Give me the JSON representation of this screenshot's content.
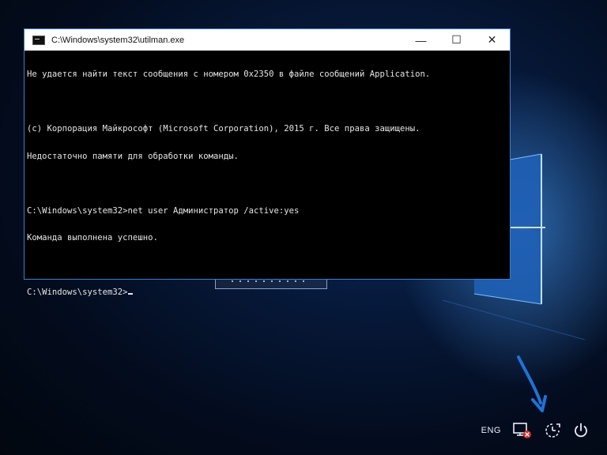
{
  "window": {
    "title": "C:\\Windows\\system32\\utilman.exe",
    "minimize_label": "—",
    "maximize_label": "☐",
    "close_label": "✕"
  },
  "console": {
    "lines": [
      "Не удается найти текст сообщения с номером 0x2350 в файле сообщений Application.",
      "",
      "(c) Корпорация Майкрософт (Microsoft Corporation), 2015 г. Все права защищены.",
      "Недостаточно памяти для обработки команды.",
      "",
      "C:\\Windows\\system32>net user Администратор /active:yes",
      "Команда выполнена успешно.",
      "",
      "C:\\Windows\\system32>"
    ]
  },
  "tray": {
    "language": "ENG",
    "icons": [
      "network-disconnected-icon",
      "ease-of-access-icon",
      "power-icon"
    ]
  },
  "colors": {
    "accent": "#3c7fd1",
    "console_bg": "#000000",
    "arrow": "#1e73d6"
  }
}
